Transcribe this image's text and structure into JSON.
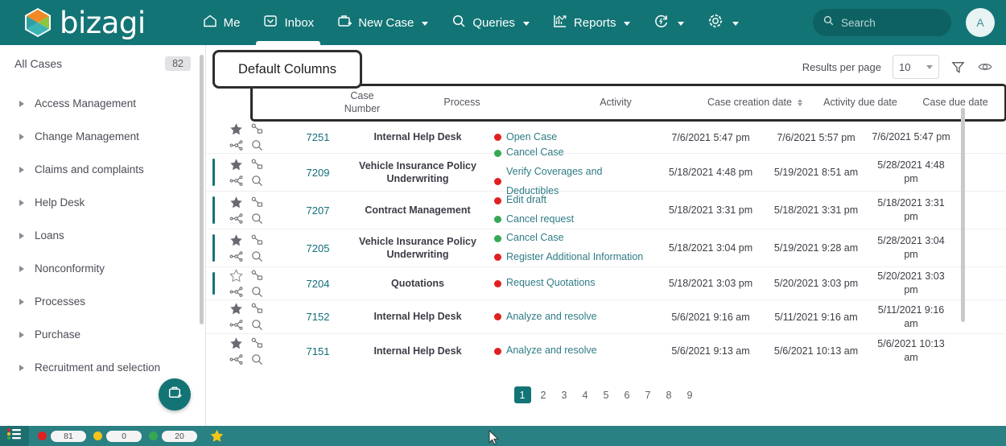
{
  "colors": {
    "brand_teal": "#137475",
    "status_bar": "#2a8183",
    "link": "#0f6e79",
    "activity_text": "#2f7c86",
    "red": "#e02020",
    "green": "#34a853",
    "yellow": "#f2c31c",
    "star_gold": "#f5c518",
    "callout_border": "#2f2f2f"
  },
  "header": {
    "brand": "bizagi",
    "brand_icon": "bizagi-logo-icon",
    "nav": [
      {
        "label": "Me",
        "icon": "home-icon",
        "caret": false,
        "active": false
      },
      {
        "label": "Inbox",
        "icon": "inbox-icon",
        "caret": false,
        "active": true
      },
      {
        "label": "New Case",
        "icon": "briefcase-plus-icon",
        "caret": true,
        "active": false
      },
      {
        "label": "Queries",
        "icon": "search-icon",
        "caret": true,
        "active": false
      },
      {
        "label": "Reports",
        "icon": "chart-icon",
        "caret": true,
        "active": false
      },
      {
        "label": "",
        "icon": "refresh-bolt-icon",
        "caret": true,
        "active": false
      },
      {
        "label": "",
        "icon": "gear-icon",
        "caret": true,
        "active": false
      }
    ],
    "search": {
      "placeholder": "Search",
      "value": "",
      "icon": "search-icon"
    },
    "avatar": {
      "initial": "A"
    }
  },
  "sidebar": {
    "all_cases_label": "All Cases",
    "all_cases_count": "82",
    "items": [
      {
        "label": "Access Management"
      },
      {
        "label": "Change Management"
      },
      {
        "label": "Claims and complaints"
      },
      {
        "label": "Help Desk"
      },
      {
        "label": "Loans"
      },
      {
        "label": "Nonconformity"
      },
      {
        "label": "Processes"
      },
      {
        "label": "Purchase"
      },
      {
        "label": "Recruitment and selection"
      }
    ],
    "fab_icon": "new-case-icon"
  },
  "callout": {
    "text": "Default Columns"
  },
  "toolbar": {
    "results_per_page_label": "Results per page",
    "results_per_page_value": "10",
    "filter_icon": "funnel-icon",
    "view_icon": "eye-icon"
  },
  "table": {
    "columns": [
      {
        "label": "Case Number",
        "sortable": false
      },
      {
        "label": "Process",
        "sortable": false
      },
      {
        "label": "Activity",
        "sortable": false
      },
      {
        "label": "Case creation date",
        "sortable": true
      },
      {
        "label": "Activity due date",
        "sortable": false
      },
      {
        "label": "Case due date",
        "sortable": false
      }
    ],
    "rows": [
      {
        "starred": true,
        "marker": false,
        "case_number": "7251",
        "process": "Internal Help Desk",
        "activities": [
          {
            "text": "Open Case",
            "status": "red"
          }
        ],
        "case_creation_date": "7/6/2021 5:47 pm",
        "activity_due_date": "7/6/2021 5:57 pm",
        "case_due_date": "7/6/2021 5:47 pm"
      },
      {
        "starred": true,
        "marker": true,
        "case_number": "7209",
        "process": "Vehicle Insurance Policy Underwriting",
        "activities": [
          {
            "text": "Cancel Case",
            "status": "green"
          },
          {
            "text": "Verify Coverages and Deductibles",
            "status": "red"
          }
        ],
        "case_creation_date": "5/18/2021 4:48 pm",
        "activity_due_date": "5/19/2021 8:51 am",
        "case_due_date": "5/28/2021 4:48 pm"
      },
      {
        "starred": true,
        "marker": true,
        "case_number": "7207",
        "process": "Contract Management",
        "activities": [
          {
            "text": "Edit draft",
            "status": "red"
          },
          {
            "text": "Cancel request",
            "status": "green"
          }
        ],
        "case_creation_date": "5/18/2021 3:31 pm",
        "activity_due_date": "5/18/2021 3:31 pm",
        "case_due_date": "5/18/2021 3:31 pm"
      },
      {
        "starred": true,
        "marker": true,
        "case_number": "7205",
        "process": "Vehicle Insurance Policy Underwriting",
        "activities": [
          {
            "text": "Cancel Case",
            "status": "green"
          },
          {
            "text": "Register Additional Information",
            "status": "red"
          }
        ],
        "case_creation_date": "5/18/2021 3:04 pm",
        "activity_due_date": "5/19/2021 9:28 am",
        "case_due_date": "5/28/2021 3:04 pm"
      },
      {
        "starred": false,
        "marker": true,
        "case_number": "7204",
        "process": "Quotations",
        "activities": [
          {
            "text": "Request Quotations",
            "status": "red"
          }
        ],
        "case_creation_date": "5/18/2021 3:03 pm",
        "activity_due_date": "5/20/2021 3:03 pm",
        "case_due_date": "5/20/2021 3:03 pm"
      },
      {
        "starred": true,
        "marker": false,
        "case_number": "7152",
        "process": "Internal Help Desk",
        "activities": [
          {
            "text": "Analyze and resolve",
            "status": "red"
          }
        ],
        "case_creation_date": "5/6/2021 9:16 am",
        "activity_due_date": "5/11/2021 9:16 am",
        "case_due_date": "5/11/2021 9:16 am"
      },
      {
        "starred": true,
        "marker": false,
        "case_number": "7151",
        "process": "Internal Help Desk",
        "activities": [
          {
            "text": "Analyze and resolve",
            "status": "red"
          }
        ],
        "case_creation_date": "5/6/2021 9:13 am",
        "activity_due_date": "5/6/2021 10:13 am",
        "case_due_date": "5/6/2021 10:13 am"
      }
    ]
  },
  "pagination": {
    "pages": [
      "1",
      "2",
      "3",
      "4",
      "5",
      "6",
      "7",
      "8",
      "9"
    ],
    "current": "1"
  },
  "statusbar": {
    "menu_icon": "list-menu-icon",
    "counters": [
      {
        "status": "red",
        "value": "81"
      },
      {
        "status": "yellow",
        "value": "0"
      },
      {
        "status": "green",
        "value": "20"
      }
    ],
    "star_icon": "star-filled-icon"
  }
}
